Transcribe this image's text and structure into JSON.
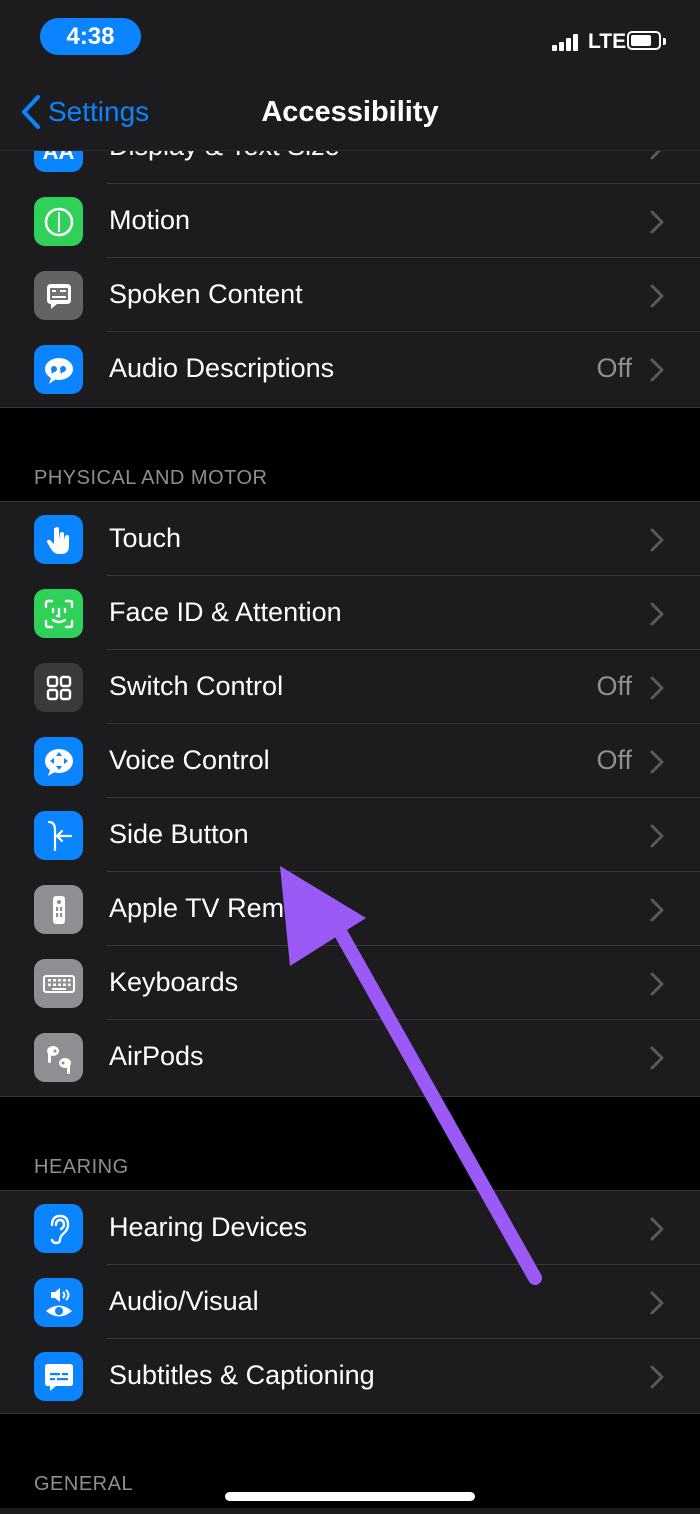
{
  "status_bar": {
    "time": "4:38",
    "network": "LTE"
  },
  "nav": {
    "back_label": "Settings",
    "title": "Accessibility"
  },
  "vision_group": {
    "rows": [
      {
        "label": "Display & Text Size",
        "value": "",
        "icon": "text-size-icon",
        "color": "#0a84ff"
      },
      {
        "label": "Motion",
        "value": "",
        "icon": "motion-icon",
        "color": "#30d158"
      },
      {
        "label": "Spoken Content",
        "value": "",
        "icon": "spoken-content-icon",
        "color": "#636366"
      },
      {
        "label": "Audio Descriptions",
        "value": "Off",
        "icon": "audio-descriptions-icon",
        "color": "#0a84ff"
      }
    ]
  },
  "physical_motor": {
    "header": "PHYSICAL AND MOTOR",
    "rows": [
      {
        "label": "Touch",
        "value": "",
        "icon": "touch-hand-icon",
        "color": "#0a84ff"
      },
      {
        "label": "Face ID & Attention",
        "value": "",
        "icon": "face-id-icon",
        "color": "#30d158"
      },
      {
        "label": "Switch Control",
        "value": "Off",
        "icon": "switch-control-icon",
        "color": "#3a3a3c"
      },
      {
        "label": "Voice Control",
        "value": "Off",
        "icon": "voice-control-icon",
        "color": "#0a84ff"
      },
      {
        "label": "Side Button",
        "value": "",
        "icon": "side-button-icon",
        "color": "#0a84ff"
      },
      {
        "label": "Apple TV Rem",
        "value": "",
        "icon": "tv-remote-icon",
        "color": "#8e8e93"
      },
      {
        "label": "Keyboards",
        "value": "",
        "icon": "keyboard-icon",
        "color": "#8e8e93"
      },
      {
        "label": "AirPods",
        "value": "",
        "icon": "airpods-icon",
        "color": "#8e8e93"
      }
    ]
  },
  "hearing": {
    "header": "HEARING",
    "rows": [
      {
        "label": "Hearing Devices",
        "value": "",
        "icon": "ear-icon",
        "color": "#0a84ff"
      },
      {
        "label": "Audio/Visual",
        "value": "",
        "icon": "audio-visual-icon",
        "color": "#0a84ff"
      },
      {
        "label": "Subtitles & Captioning",
        "value": "",
        "icon": "subtitles-icon",
        "color": "#0a84ff"
      }
    ]
  },
  "general": {
    "header": "GENERAL"
  },
  "annotation": {
    "arrow_color": "#9b59f5"
  }
}
